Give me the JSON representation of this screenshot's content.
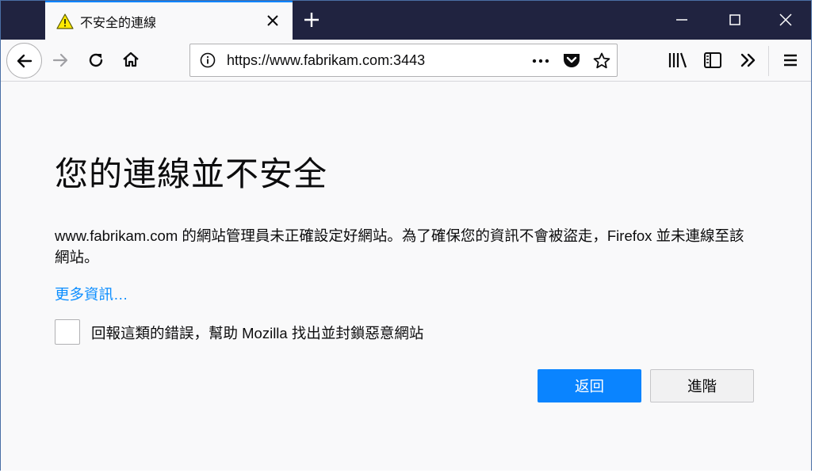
{
  "tab": {
    "title": "不安全的連線",
    "icon": "warning-icon"
  },
  "navbar": {
    "url": "https://www.fabrikam.com:3443"
  },
  "content": {
    "title": "您的連線並不安全",
    "description": "www.fabrikam.com 的網站管理員未正確設定好網站。為了確保您的資訊不會被盜走，Firefox 並未連線至該網站。",
    "more_info": "更多資訊…",
    "report_label": "回報這類的錯誤，幫助 Mozilla 找出並封鎖惡意網站",
    "report_checked": false,
    "go_back_label": "返回",
    "advanced_label": "進階"
  },
  "colors": {
    "tabbar_bg": "#202340",
    "accent": "#0a84ff",
    "link": "#0a8dff"
  }
}
